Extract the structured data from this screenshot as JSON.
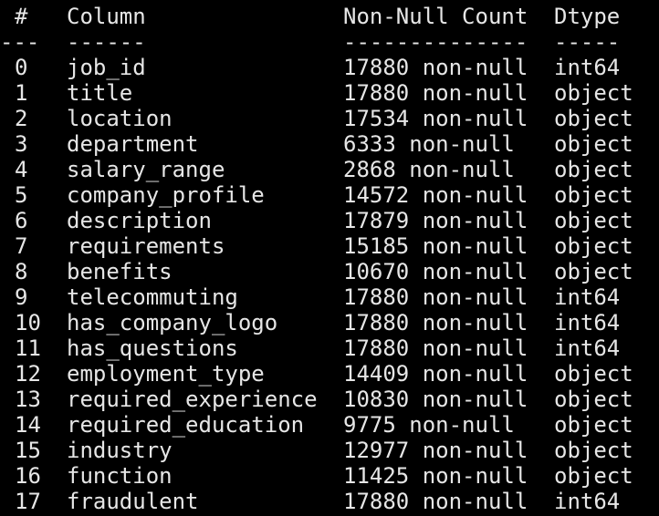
{
  "header": {
    "index": "#",
    "column": "Column",
    "non_null": "Non-Null Count",
    "dtype": "Dtype"
  },
  "separator": {
    "index": "---",
    "column": "------",
    "non_null": "--------------",
    "dtype": "-----"
  },
  "rows": [
    {
      "index": "0",
      "column": "job_id",
      "non_null": "17880 non-null",
      "dtype": "int64"
    },
    {
      "index": "1",
      "column": "title",
      "non_null": "17880 non-null",
      "dtype": "object"
    },
    {
      "index": "2",
      "column": "location",
      "non_null": "17534 non-null",
      "dtype": "object"
    },
    {
      "index": "3",
      "column": "department",
      "non_null": "6333 non-null",
      "dtype": "object"
    },
    {
      "index": "4",
      "column": "salary_range",
      "non_null": "2868 non-null",
      "dtype": "object"
    },
    {
      "index": "5",
      "column": "company_profile",
      "non_null": "14572 non-null",
      "dtype": "object"
    },
    {
      "index": "6",
      "column": "description",
      "non_null": "17879 non-null",
      "dtype": "object"
    },
    {
      "index": "7",
      "column": "requirements",
      "non_null": "15185 non-null",
      "dtype": "object"
    },
    {
      "index": "8",
      "column": "benefits",
      "non_null": "10670 non-null",
      "dtype": "object"
    },
    {
      "index": "9",
      "column": "telecommuting",
      "non_null": "17880 non-null",
      "dtype": "int64"
    },
    {
      "index": "10",
      "column": "has_company_logo",
      "non_null": "17880 non-null",
      "dtype": "int64"
    },
    {
      "index": "11",
      "column": "has_questions",
      "non_null": "17880 non-null",
      "dtype": "int64"
    },
    {
      "index": "12",
      "column": "employment_type",
      "non_null": "14409 non-null",
      "dtype": "object"
    },
    {
      "index": "13",
      "column": "required_experience",
      "non_null": "10830 non-null",
      "dtype": "object"
    },
    {
      "index": "14",
      "column": "required_education",
      "non_null": "9775 non-null",
      "dtype": "object"
    },
    {
      "index": "15",
      "column": "industry",
      "non_null": "12977 non-null",
      "dtype": "object"
    },
    {
      "index": "16",
      "column": "function",
      "non_null": "11425 non-null",
      "dtype": "object"
    },
    {
      "index": "17",
      "column": "fraudulent",
      "non_null": "17880 non-null",
      "dtype": "int64"
    }
  ],
  "colors": {
    "background": "#000000",
    "text": "#e6e6e6"
  }
}
